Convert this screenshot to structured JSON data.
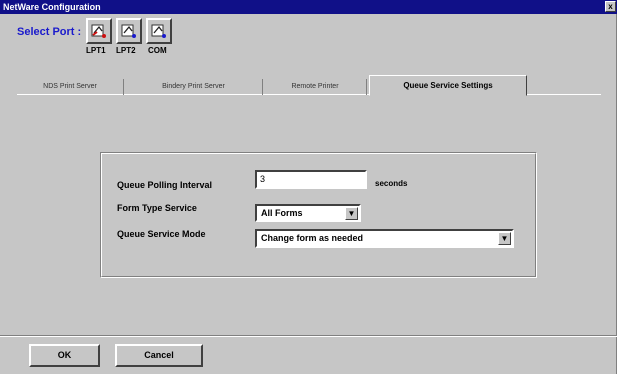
{
  "window": {
    "title": "NetWare Configuration",
    "close_glyph": "x"
  },
  "select_port": {
    "label": "Select Port :",
    "ports": [
      "LPT1",
      "LPT2",
      "COM"
    ]
  },
  "tabs": [
    {
      "label": "NDS Print Server"
    },
    {
      "label": "Bindery Print Server"
    },
    {
      "label": "Remote Printer"
    },
    {
      "label": "Queue Service Settings"
    }
  ],
  "form": {
    "polling_label": "Queue Polling Interval",
    "polling_value": "3",
    "polling_unit": "seconds",
    "form_type_label": "Form Type Service",
    "form_type_value": "All Forms",
    "mode_label": "Queue Service Mode",
    "mode_value": "Change form as needed",
    "arrow_glyph": "▼"
  },
  "buttons": {
    "ok": "OK",
    "cancel": "Cancel"
  },
  "colors": {
    "title_bar": "#101088",
    "select_port_text": "#1a1acc",
    "dialog_bg": "#c6c6c6"
  },
  "icons": [
    "printer-port-icon"
  ]
}
